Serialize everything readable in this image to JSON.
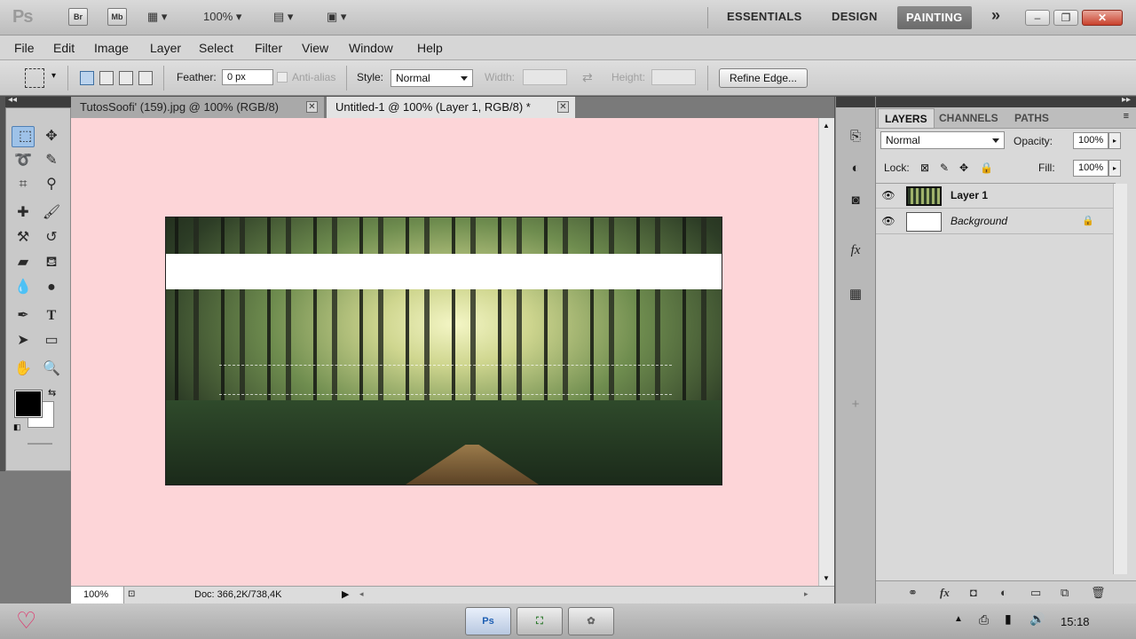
{
  "app": {
    "logo": "Ps",
    "bridge_label": "Br",
    "minibridge_label": "Mb",
    "zoom": "100%",
    "workspaces": [
      "ESSENTIALS",
      "DESIGN",
      "PAINTING"
    ],
    "active_workspace": "PAINTING",
    "more_label": "»"
  },
  "menu": [
    "File",
    "Edit",
    "Image",
    "Layer",
    "Select",
    "Filter",
    "View",
    "Window",
    "Help"
  ],
  "options": {
    "feather_label": "Feather:",
    "feather_value": "0 px",
    "antialias_label": "Anti-alias",
    "style_label": "Style:",
    "style_value": "Normal",
    "width_label": "Width:",
    "height_label": "Height:",
    "refine_edge": "Refine Edge..."
  },
  "tabs": [
    {
      "title": "TutosSoofi' (159).jpg @ 100% (RGB/8)",
      "active": false
    },
    {
      "title": "Untitled-1 @ 100% (Layer 1, RGB/8) *",
      "active": true
    }
  ],
  "status": {
    "zoom": "100%",
    "doc": "Doc: 366,2K/738,4K"
  },
  "layers_panel": {
    "tabs": [
      "LAYERS",
      "CHANNELS",
      "PATHS"
    ],
    "active_tab": "LAYERS",
    "blend_mode": "Normal",
    "opacity_label": "Opacity:",
    "opacity_value": "100%",
    "lock_label": "Lock:",
    "fill_label": "Fill:",
    "fill_value": "100%",
    "layers": [
      {
        "name": "Layer 1",
        "selected": true
      },
      {
        "name": "Background",
        "selected": false,
        "locked": true
      }
    ]
  },
  "taskbar": {
    "time": "15:18",
    "apps": [
      "Ps"
    ]
  },
  "colors": {
    "canvas_background": "#fdd5d8",
    "foreground_color": "#000000",
    "background_color": "#ffffff",
    "active_workspace_bg": "#7a7a7a"
  },
  "icons": {
    "toolbox": [
      "rect-marquee-icon",
      "move-icon",
      "lasso-icon",
      "quick-select-icon",
      "crop-icon",
      "eyedropper-icon",
      "healing-brush-icon",
      "brush-icon",
      "clone-stamp-icon",
      "history-brush-icon",
      "eraser-icon",
      "paint-bucket-icon",
      "blur-icon",
      "dodge-icon",
      "pen-icon",
      "type-icon",
      "path-select-icon",
      "rectangle-shape-icon",
      "hand-icon",
      "zoom-icon"
    ]
  }
}
